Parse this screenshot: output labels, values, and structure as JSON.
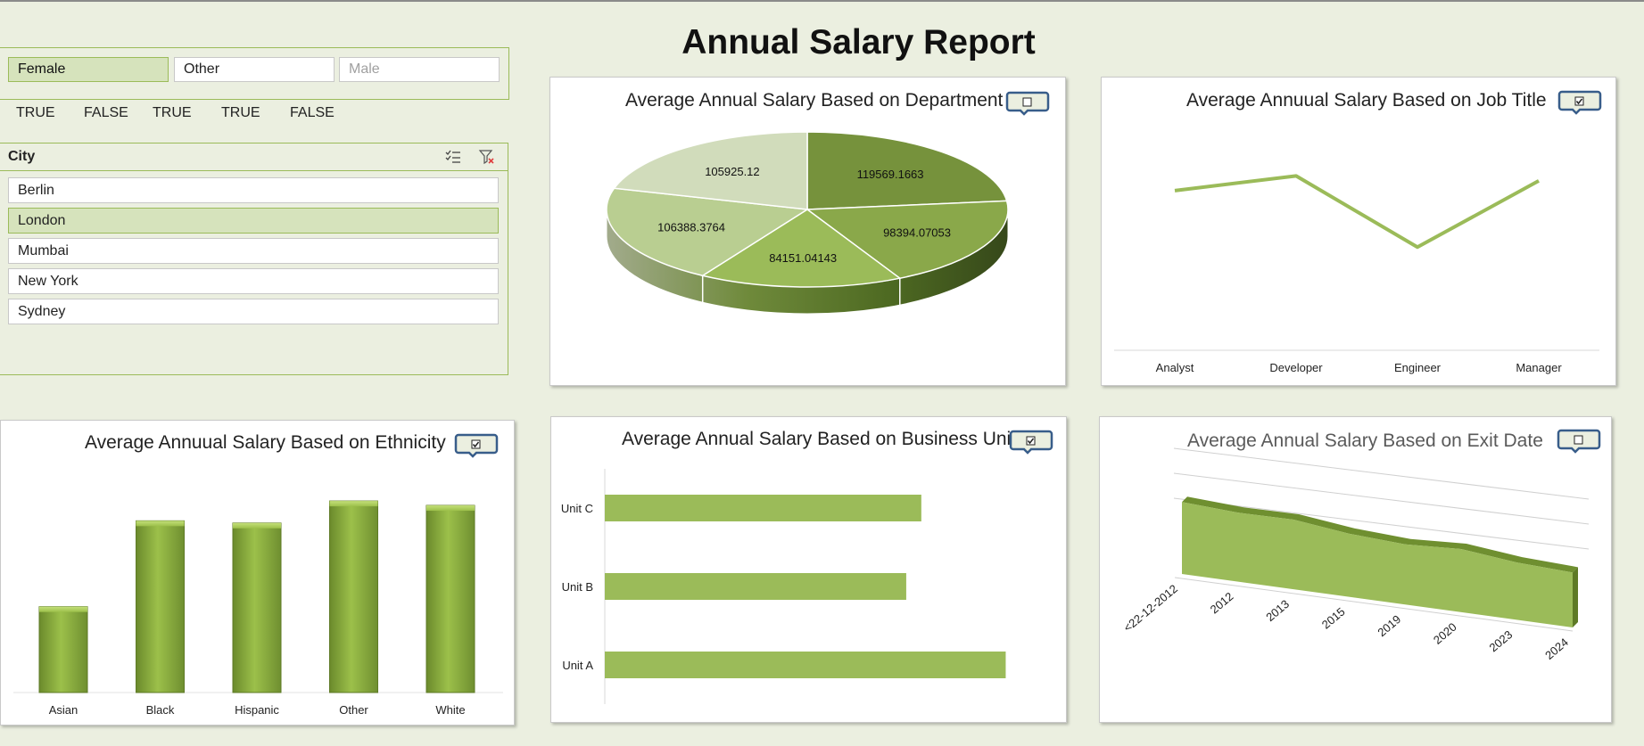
{
  "page_title": "Annual Salary Report",
  "gender_slicer": {
    "buttons": [
      {
        "label": "Female",
        "state": "selected"
      },
      {
        "label": "Other",
        "state": "available"
      },
      {
        "label": "Male",
        "state": "no-data"
      }
    ],
    "flags": [
      "TRUE",
      "FALSE",
      "TRUE",
      "TRUE",
      "FALSE"
    ]
  },
  "city_slicer": {
    "header": "City",
    "icons": [
      "multi-select-icon",
      "clear-filter-icon"
    ],
    "items": [
      {
        "label": "Berlin",
        "selected": false
      },
      {
        "label": "London",
        "selected": true
      },
      {
        "label": "Mumbai",
        "selected": false
      },
      {
        "label": "New York",
        "selected": false
      },
      {
        "label": "Sydney",
        "selected": false
      }
    ]
  },
  "colors": {
    "accent": "#9bbb59",
    "dark_green": "#76923c",
    "slicer_selected": "#d6e3bc",
    "background": "#ebefe0",
    "checkbox_border": "#385d8a"
  },
  "panels": {
    "department": {
      "title": "Average Annual Salary Based on Department",
      "checkbox_checked": false
    },
    "job_title": {
      "title": "Average Annuual Salary Based on Job Title",
      "checkbox_checked": true
    },
    "ethnicity": {
      "title": "Average Annuual Salary Based on Ethnicity",
      "checkbox_checked": true
    },
    "business_unit": {
      "title": "Average Annual Salary Based on Business Unit",
      "checkbox_checked": true
    },
    "exit_date": {
      "title": "Average Annual Salary Based on Exit Date",
      "checkbox_checked": false
    }
  },
  "chart_data": [
    {
      "id": "department",
      "type": "pie",
      "title": "Average Annual Salary Based on Department",
      "style": "3d",
      "values": [
        119569.1663,
        98394.07053,
        84151.04143,
        106388.3764,
        105925.12
      ],
      "labels": [
        "119569.1663",
        "98394.07053",
        "84151.04143",
        "106388.3764",
        "105925.12"
      ],
      "colors": [
        "#76923c",
        "#8aa84a",
        "#9bbb59",
        "#b9ce91",
        "#d1dcbb"
      ]
    },
    {
      "id": "job_title",
      "type": "line",
      "title": "Average Annuual Salary Based on Job Title",
      "categories": [
        "Analyst",
        "Developer",
        "Engineer",
        "Manager"
      ],
      "values": [
        105000,
        111000,
        82000,
        109000
      ],
      "ylim": [
        40000,
        130000
      ],
      "grid": false
    },
    {
      "id": "ethnicity",
      "type": "bar",
      "title": "Average Annuual Salary Based on Ethnicity",
      "categories": [
        "Asian",
        "Black",
        "Hispanic",
        "Other",
        "White"
      ],
      "values": [
        78000,
        156000,
        154000,
        174000,
        170000
      ],
      "ylim": [
        0,
        200000
      ],
      "style": "3d"
    },
    {
      "id": "business_unit",
      "type": "bar",
      "orientation": "horizontal",
      "title": "Average Annual Salary Based on Business Unit",
      "categories": [
        "Unit C",
        "Unit B",
        "Unit A"
      ],
      "values": [
        105000,
        100000,
        133000
      ],
      "xlim": [
        0,
        145000
      ]
    },
    {
      "id": "exit_date",
      "type": "area",
      "style": "3d",
      "title": "Average Annual Salary Based on Exit Date",
      "categories": [
        "<22-12-2012",
        "2012",
        "2013",
        "2015",
        "2019",
        "2020",
        "2023",
        "2024"
      ],
      "values": [
        123000,
        118000,
        119000,
        108000,
        103000,
        108000,
        98000,
        94000
      ],
      "ylim": [
        0,
        160000
      ]
    }
  ]
}
